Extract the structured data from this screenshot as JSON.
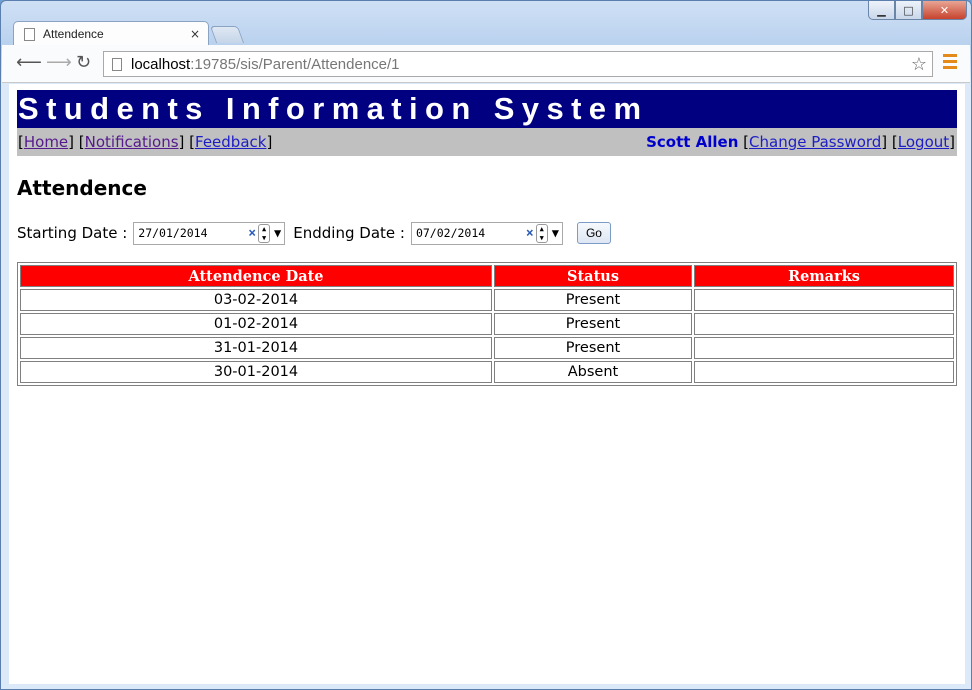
{
  "browser": {
    "tab_title": "Attendence",
    "tab_close": "×",
    "url_host": "localhost",
    "url_path": ":19785/sis/Parent/Attendence/1"
  },
  "site": {
    "header_title": "Students Information System"
  },
  "nav": {
    "home": "Home",
    "notifications": "Notifications",
    "feedback": "Feedback",
    "user_name": "Scott Allen",
    "change_password": "Change Password",
    "logout": "Logout"
  },
  "page": {
    "title": "Attendence"
  },
  "filter": {
    "start_label": "Starting Date :",
    "start_value": "27/01/2014",
    "end_label": "Endding Date :",
    "end_value": "07/02/2014",
    "go_label": "Go"
  },
  "table": {
    "headers": [
      "Attendence Date",
      "Status",
      "Remarks"
    ],
    "rows": [
      {
        "date": "03-02-2014",
        "status": "Present",
        "remarks": ""
      },
      {
        "date": "01-02-2014",
        "status": "Present",
        "remarks": ""
      },
      {
        "date": "31-01-2014",
        "status": "Present",
        "remarks": ""
      },
      {
        "date": "30-01-2014",
        "status": "Absent",
        "remarks": ""
      }
    ]
  },
  "colors": {
    "header_bg": "#000080",
    "nav_bg": "#c0c0c0",
    "table_header_bg": "#ff0000"
  }
}
